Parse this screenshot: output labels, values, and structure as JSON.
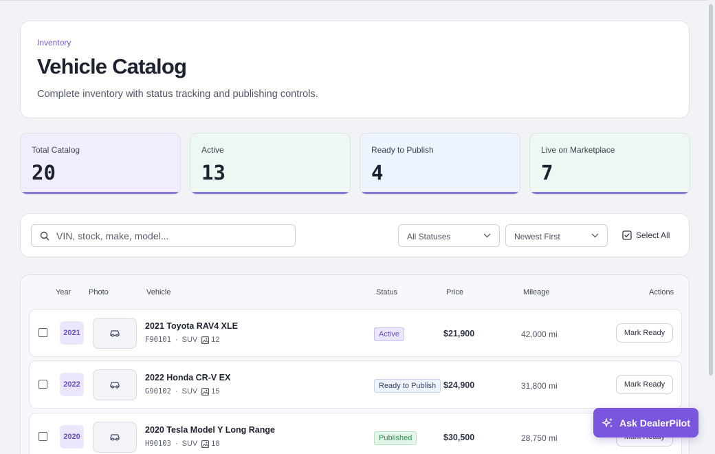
{
  "header": {
    "eyebrow": "Inventory",
    "title": "Vehicle Catalog",
    "subtitle": "Complete inventory with status tracking and publishing controls."
  },
  "stats": [
    {
      "label": "Total Catalog",
      "value": "20"
    },
    {
      "label": "Active",
      "value": "13"
    },
    {
      "label": "Ready to Publish",
      "value": "4"
    },
    {
      "label": "Live on Marketplace",
      "value": "7"
    }
  ],
  "filters": {
    "search_placeholder": "VIN, stock, make, model...",
    "status_select": "All Statuses",
    "sort_select": "Newest First",
    "select_all": "Select All"
  },
  "table": {
    "columns": {
      "year": "Year",
      "photo": "Photo",
      "vehicle": "Vehicle",
      "status": "Status",
      "price": "Price",
      "mileage": "Mileage",
      "actions": "Actions"
    },
    "rows": [
      {
        "year": "2021",
        "name": "2021 Toyota RAV4 XLE",
        "stock": "F90101",
        "body": "SUV",
        "photos": "12",
        "status": "Active",
        "price": "$21,900",
        "mileage": "42,000 mi",
        "action": "Mark Ready"
      },
      {
        "year": "2022",
        "name": "2022 Honda CR-V EX",
        "stock": "G90102",
        "body": "SUV",
        "photos": "15",
        "status": "Ready to Publish",
        "price": "$24,900",
        "mileage": "31,800 mi",
        "action": "Mark Ready"
      },
      {
        "year": "2020",
        "name": "2020 Tesla Model Y Long Range",
        "stock": "H90103",
        "body": "SUV",
        "photos": "18",
        "status": "Published",
        "price": "$30,500",
        "mileage": "28,750 mi",
        "action": "Mark Ready"
      }
    ]
  },
  "assistant_button": "Ask DealerPilot",
  "separator": "·"
}
